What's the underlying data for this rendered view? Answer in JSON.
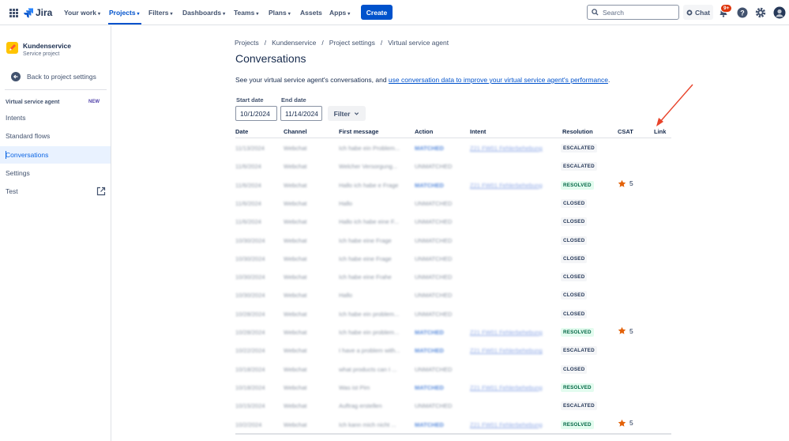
{
  "topnav": {
    "logo_text": "Jira",
    "items": [
      {
        "label": "Your work",
        "caret": "▾"
      },
      {
        "label": "Projects",
        "caret": "▾"
      },
      {
        "label": "Filters",
        "caret": "▾"
      },
      {
        "label": "Dashboards",
        "caret": "▾"
      },
      {
        "label": "Teams",
        "caret": "▾"
      },
      {
        "label": "Plans",
        "caret": "▾"
      },
      {
        "label": "Assets",
        "caret": ""
      },
      {
        "label": "Apps",
        "caret": "▾"
      }
    ],
    "active_item": "Projects",
    "create_label": "Create",
    "search_placeholder": "Search",
    "chat_label": "Chat",
    "notification_badge": "9+",
    "accent_color": "#0052cc"
  },
  "sidebar": {
    "project_name": "Kundenservice",
    "project_type": "Service project",
    "back_label": "Back to project settings",
    "section_label": "Virtual service agent",
    "section_badge": "NEW",
    "items": [
      {
        "label": "Intents"
      },
      {
        "label": "Standard flows"
      },
      {
        "label": "Conversations"
      },
      {
        "label": "Settings"
      },
      {
        "label": "Test"
      }
    ],
    "active_item": "Conversations"
  },
  "main": {
    "breadcrumb": [
      "Projects",
      "Kundenservice",
      "Project settings",
      "Virtual service agent"
    ],
    "breadcrumb_separator": "/",
    "title": "Conversations",
    "description_prefix": "See your virtual service agent's conversations, and ",
    "description_link": "use conversation data to improve your virtual service agent's performance",
    "description_suffix": ".",
    "start_date_label": "Start date",
    "start_date_value": "10/1/2024",
    "end_date_label": "End date",
    "end_date_value": "11/14/2024",
    "filter_label": "Filter"
  },
  "table": {
    "columns": [
      "Date",
      "Channel",
      "First message",
      "Action",
      "Intent",
      "Resolution",
      "CSAT",
      "Link"
    ],
    "rows": [
      {
        "date": "11/13/2024",
        "channel": "Webchat",
        "first_message": "Ich habe ein Problem...",
        "action": "MATCHED",
        "intent": "Z21 FW01 Fehlerbehebung",
        "resolution": "ESCALATED",
        "csat": ""
      },
      {
        "date": "11/6/2024",
        "channel": "Webchat",
        "first_message": "Welcher Versorgung...",
        "action": "UNMATCHED",
        "intent": "",
        "resolution": "ESCALATED",
        "csat": ""
      },
      {
        "date": "11/6/2024",
        "channel": "Webchat",
        "first_message": "Hallo ich habe e Frage",
        "action": "MATCHED",
        "intent": "Z21 FW01 Fehlerbehebung",
        "resolution": "RESOLVED",
        "csat": "5"
      },
      {
        "date": "11/6/2024",
        "channel": "Webchat",
        "first_message": "Hallo",
        "action": "UNMATCHED",
        "intent": "",
        "resolution": "CLOSED",
        "csat": ""
      },
      {
        "date": "11/6/2024",
        "channel": "Webchat",
        "first_message": "Hallo ich habe eine F...",
        "action": "UNMATCHED",
        "intent": "",
        "resolution": "CLOSED",
        "csat": ""
      },
      {
        "date": "10/30/2024",
        "channel": "Webchat",
        "first_message": "Ich habe eine Frage",
        "action": "UNMATCHED",
        "intent": "",
        "resolution": "CLOSED",
        "csat": ""
      },
      {
        "date": "10/30/2024",
        "channel": "Webchat",
        "first_message": "Ich habe eine Frage",
        "action": "UNMATCHED",
        "intent": "",
        "resolution": "CLOSED",
        "csat": ""
      },
      {
        "date": "10/30/2024",
        "channel": "Webchat",
        "first_message": "Ich habe eine Frahe",
        "action": "UNMATCHED",
        "intent": "",
        "resolution": "CLOSED",
        "csat": ""
      },
      {
        "date": "10/30/2024",
        "channel": "Webchat",
        "first_message": "Hallo",
        "action": "UNMATCHED",
        "intent": "",
        "resolution": "CLOSED",
        "csat": ""
      },
      {
        "date": "10/28/2024",
        "channel": "Webchat",
        "first_message": "Ich habe ein problem...",
        "action": "UNMATCHED",
        "intent": "",
        "resolution": "CLOSED",
        "csat": ""
      },
      {
        "date": "10/28/2024",
        "channel": "Webchat",
        "first_message": "Ich habe ein problem...",
        "action": "MATCHED",
        "intent": "Z21 FW01 Fehlerbehebung",
        "resolution": "RESOLVED",
        "csat": "5"
      },
      {
        "date": "10/22/2024",
        "channel": "Webchat",
        "first_message": "I have a problem with...",
        "action": "MATCHED",
        "intent": "Z21 FW01 Fehlerbehebung",
        "resolution": "ESCALATED",
        "csat": ""
      },
      {
        "date": "10/18/2024",
        "channel": "Webchat",
        "first_message": "what products can I ...",
        "action": "UNMATCHED",
        "intent": "",
        "resolution": "CLOSED",
        "csat": ""
      },
      {
        "date": "10/18/2024",
        "channel": "Webchat",
        "first_message": "Was ist Pim",
        "action": "MATCHED",
        "intent": "Z21 FW01 Fehlerbehebung",
        "resolution": "RESOLVED",
        "csat": ""
      },
      {
        "date": "10/15/2024",
        "channel": "Webchat",
        "first_message": "Auftrag erstellen",
        "action": "UNMATCHED",
        "intent": "",
        "resolution": "ESCALATED",
        "csat": ""
      },
      {
        "date": "10/2/2024",
        "channel": "Webchat",
        "first_message": "Ich kann mich nicht ...",
        "action": "MATCHED",
        "intent": "Z21 FW01 Fehlerbehebung",
        "resolution": "RESOLVED",
        "csat": "5"
      }
    ]
  },
  "annotation": {
    "type": "arrow",
    "points_to": "Link",
    "color": "#e8432a"
  }
}
